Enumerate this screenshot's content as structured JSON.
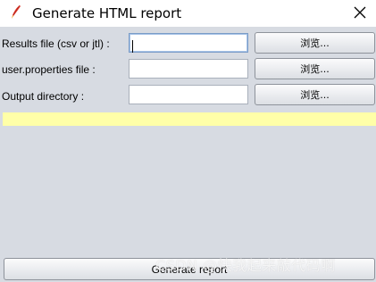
{
  "window": {
    "title": "Generate HTML report",
    "icon": "feather-pen-icon",
    "close_icon": "close-icon"
  },
  "form": {
    "results_file_label": "Results file (csv or jtl) :",
    "results_file_value": "",
    "user_properties_label": "user.properties file :",
    "user_properties_value": "",
    "output_directory_label": "Output directory :",
    "output_directory_value": "",
    "browse_label": "浏览..."
  },
  "status": {
    "message": "",
    "color": "#ffffa8"
  },
  "actions": {
    "generate_label": "Generate report"
  },
  "watermark": "CSDN @快我起来敲代码啊",
  "colors": {
    "panel_background": "#d7dbe2",
    "status_background": "#ffffa8"
  }
}
